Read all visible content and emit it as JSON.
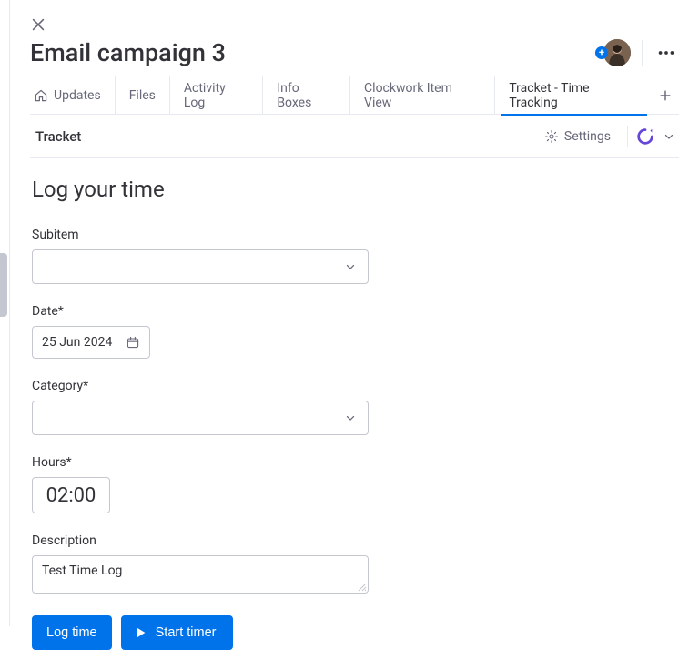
{
  "header": {
    "title": "Email campaign 3"
  },
  "tabs": {
    "items": [
      {
        "label": "Updates"
      },
      {
        "label": "Files"
      },
      {
        "label": "Activity Log"
      },
      {
        "label": "Info Boxes"
      },
      {
        "label": "Clockwork Item View"
      },
      {
        "label": "Tracket - Time Tracking"
      }
    ]
  },
  "subbar": {
    "title": "Tracket",
    "settings_label": "Settings"
  },
  "form": {
    "heading": "Log your time",
    "subitem_label": "Subitem",
    "date_label": "Date*",
    "date_value": "25 Jun 2024",
    "category_label": "Category*",
    "hours_label": "Hours*",
    "hours_value": "02:00",
    "description_label": "Description",
    "description_value": "Test Time Log",
    "log_button": "Log time",
    "timer_button": "Start timer"
  }
}
